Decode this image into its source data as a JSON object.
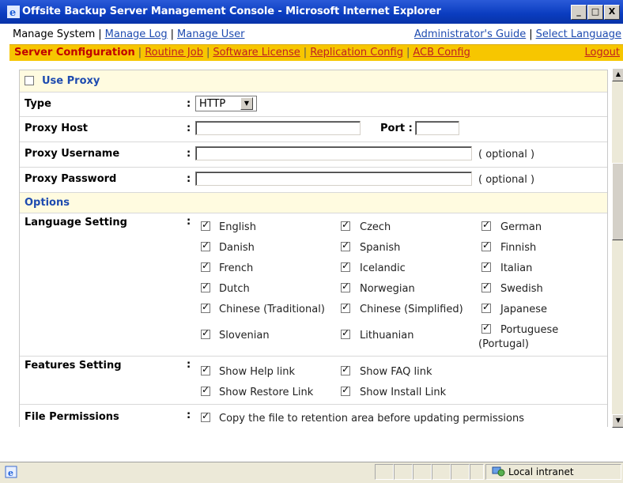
{
  "window": {
    "title": "Offsite Backup Server Management Console - Microsoft Internet Explorer",
    "min": "_",
    "max": "□",
    "close": "X"
  },
  "nav_top": {
    "items": [
      "Manage System",
      "Manage Log",
      "Manage User"
    ],
    "right": [
      "Administrator's Guide",
      "Select Language"
    ]
  },
  "nav_second": {
    "items": [
      "Server Configuration",
      "Routine Job",
      "Software License",
      "Replication Config",
      "ACB Config"
    ],
    "logout": "Logout"
  },
  "proxy": {
    "use_proxy_label": "Use Proxy",
    "use_proxy_checked": false,
    "type_label": "Type",
    "type_value": "HTTP",
    "host_label": "Proxy Host",
    "port_label": "Port :",
    "username_label": "Proxy Username",
    "password_label": "Proxy Password",
    "optional": "( optional )",
    "colon": ":"
  },
  "options": {
    "header": "Options",
    "language_label": "Language Setting",
    "languages": [
      "English",
      "Czech",
      "German",
      "Danish",
      "Spanish",
      "Finnish",
      "French",
      "Icelandic",
      "Italian",
      "Dutch",
      "Norwegian",
      "Swedish",
      "Chinese (Traditional)",
      "Chinese (Simplified)",
      "Japanese",
      "Slovenian",
      "Lithuanian",
      "Portuguese"
    ],
    "portugal_suffix": "(Portugal)",
    "features_label": "Features Setting",
    "features": [
      "Show Help link",
      "Show FAQ link",
      "Show Restore Link",
      "Show Install Link"
    ],
    "file_perm_label": "File Permissions",
    "file_perm_option": "Copy the file to retention area before updating permissions"
  },
  "status": {
    "zone": "Local intranet"
  },
  "colors": {
    "titlebar": "#0a3cbf",
    "nav_accent": "#f7c600",
    "link": "#1e4bb0",
    "active_tab": "#c00000"
  }
}
